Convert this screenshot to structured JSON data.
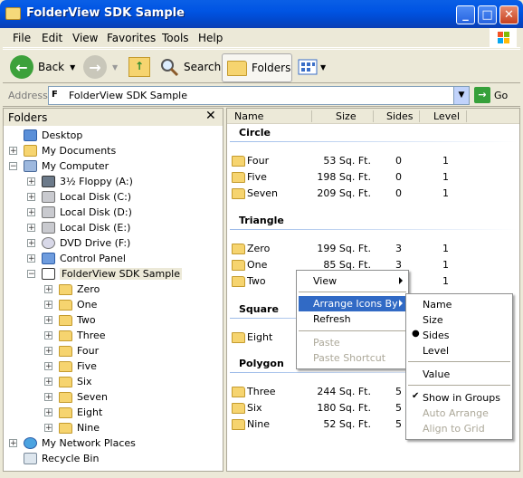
{
  "window": {
    "title": "FolderView SDK Sample",
    "min": "_",
    "max": "□",
    "close": "✕"
  },
  "menubar": [
    "File",
    "Edit",
    "View",
    "Favorites",
    "Tools",
    "Help"
  ],
  "toolbar": {
    "back": "Back",
    "search": "Search",
    "folders": "Folders"
  },
  "address": {
    "label": "Address",
    "value": "FolderView SDK Sample",
    "go": "Go"
  },
  "folders_pane": {
    "title": "Folders",
    "close": "✕",
    "tree": [
      {
        "label": "Desktop",
        "icon": "desktop-icon",
        "exp": ""
      },
      {
        "label": "My Documents",
        "icon": "documents-icon",
        "exp": "+"
      },
      {
        "label": "My Computer",
        "icon": "computer-icon",
        "exp": "−"
      },
      {
        "label": "3½ Floppy (A:)",
        "icon": "floppy-icon",
        "exp": "+"
      },
      {
        "label": "Local Disk (C:)",
        "icon": "disk-icon",
        "exp": "+"
      },
      {
        "label": "Local Disk (D:)",
        "icon": "disk-icon",
        "exp": "+"
      },
      {
        "label": "Local Disk (E:)",
        "icon": "disk-icon",
        "exp": "+"
      },
      {
        "label": "DVD Drive (F:)",
        "icon": "dvd-icon",
        "exp": "+"
      },
      {
        "label": "Control Panel",
        "icon": "control-panel-icon",
        "exp": "+"
      },
      {
        "label": "FolderView SDK Sample",
        "icon": "namespace-icon",
        "exp": "−"
      },
      {
        "label": "Zero",
        "icon": "folder-icon",
        "exp": "+"
      },
      {
        "label": "One",
        "icon": "folder-icon",
        "exp": "+"
      },
      {
        "label": "Two",
        "icon": "folder-icon",
        "exp": "+"
      },
      {
        "label": "Three",
        "icon": "folder-icon",
        "exp": "+"
      },
      {
        "label": "Four",
        "icon": "folder-icon",
        "exp": "+"
      },
      {
        "label": "Five",
        "icon": "folder-icon",
        "exp": "+"
      },
      {
        "label": "Six",
        "icon": "folder-icon",
        "exp": "+"
      },
      {
        "label": "Seven",
        "icon": "folder-icon",
        "exp": "+"
      },
      {
        "label": "Eight",
        "icon": "folder-icon",
        "exp": "+"
      },
      {
        "label": "Nine",
        "icon": "folder-icon",
        "exp": "+"
      },
      {
        "label": "My Network Places",
        "icon": "network-icon",
        "exp": "+"
      },
      {
        "label": "Recycle Bin",
        "icon": "recycle-bin-icon",
        "exp": ""
      }
    ]
  },
  "list": {
    "columns": [
      "Name",
      "Size",
      "Sides",
      "Level"
    ],
    "groups": [
      {
        "name": "Circle",
        "rows": [
          {
            "name": "Four",
            "size": "53 Sq. Ft.",
            "sides": "0",
            "level": "1"
          },
          {
            "name": "Five",
            "size": "198 Sq. Ft.",
            "sides": "0",
            "level": "1"
          },
          {
            "name": "Seven",
            "size": "209 Sq. Ft.",
            "sides": "0",
            "level": "1"
          }
        ]
      },
      {
        "name": "Triangle",
        "rows": [
          {
            "name": "Zero",
            "size": "199 Sq. Ft.",
            "sides": "3",
            "level": "1"
          },
          {
            "name": "One",
            "size": "85 Sq. Ft.",
            "sides": "3",
            "level": "1"
          },
          {
            "name": "Two",
            "size": "",
            "sides": "",
            "level": "1"
          }
        ]
      },
      {
        "name": "Square",
        "rows": [
          {
            "name": "Eight",
            "size": "",
            "sides": "",
            "level": ""
          }
        ]
      },
      {
        "name": "Polygon",
        "rows": [
          {
            "name": "Three",
            "size": "244 Sq. Ft.",
            "sides": "5",
            "level": ""
          },
          {
            "name": "Six",
            "size": "180 Sq. Ft.",
            "sides": "5",
            "level": ""
          },
          {
            "name": "Nine",
            "size": "52 Sq. Ft.",
            "sides": "5",
            "level": ""
          }
        ]
      }
    ]
  },
  "context_menu": {
    "view": "View",
    "arrange": "Arrange Icons By",
    "refresh": "Refresh",
    "paste": "Paste",
    "paste_shortcut": "Paste Shortcut"
  },
  "arrange_submenu": {
    "name": "Name",
    "size": "Size",
    "sides": "Sides",
    "level": "Level",
    "value": "Value",
    "show_in_groups": "Show in Groups",
    "auto_arrange": "Auto Arrange",
    "align_to_grid": "Align to Grid",
    "bullet": "●",
    "check": "✔"
  }
}
